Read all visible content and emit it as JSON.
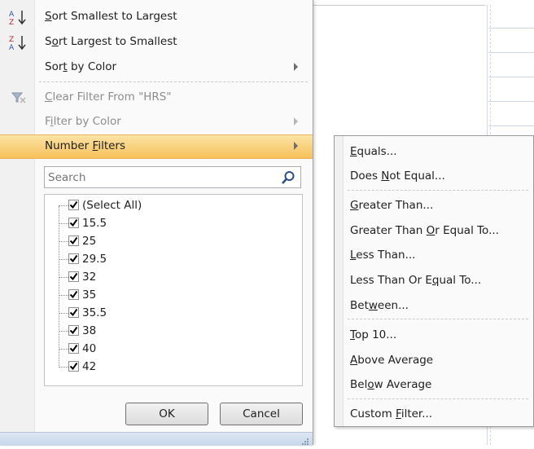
{
  "sort_menu": {
    "sort_asc": {
      "pre": "",
      "u": "S",
      "post": "ort Smallest to Largest",
      "icon": "sort-ascending-icon",
      "glyph_top": "A",
      "glyph_bottom": "Z"
    },
    "sort_desc": {
      "pre": "S",
      "u": "o",
      "post": "rt Largest to Smallest",
      "icon": "sort-descending-icon",
      "glyph_top": "Z",
      "glyph_bottom": "A"
    },
    "sort_by_color": {
      "pre": "Sor",
      "u": "t",
      "post": " by Color"
    }
  },
  "filter_menu": {
    "clear_filter": {
      "pre": "",
      "u": "C",
      "post": "lear Filter From \"HRS\"",
      "icon": "clear-filter-icon"
    },
    "filter_by_color": {
      "pre": "F",
      "u": "i",
      "post": "lter by Color"
    },
    "number_filters": {
      "pre": "Number ",
      "u": "F",
      "post": "ilters"
    }
  },
  "search": {
    "placeholder": "Search",
    "icon": "search-icon"
  },
  "values": {
    "select_all": "(Select All)",
    "items": [
      "15.5",
      "25",
      "29.5",
      "32",
      "35",
      "35.5",
      "38",
      "40",
      "42"
    ]
  },
  "buttons": {
    "ok": "OK",
    "cancel": "Cancel"
  },
  "submenu": {
    "equals": {
      "pre": "",
      "u": "E",
      "post": "quals..."
    },
    "does_not_equal": {
      "pre": "Does ",
      "u": "N",
      "post": "ot Equal..."
    },
    "greater_than": {
      "pre": "",
      "u": "G",
      "post": "reater Than..."
    },
    "greater_equal": {
      "pre": "Greater Than ",
      "u": "O",
      "post": "r Equal To..."
    },
    "less_than": {
      "pre": "",
      "u": "L",
      "post": "ess Than..."
    },
    "less_equal": {
      "pre": "Less Than Or E",
      "u": "q",
      "post": "ual To..."
    },
    "between": {
      "pre": "Bet",
      "u": "w",
      "post": "een..."
    },
    "top10": {
      "pre": "",
      "u": "T",
      "post": "op 10..."
    },
    "above_average": {
      "pre": "",
      "u": "A",
      "post": "bove Average"
    },
    "below_average": {
      "pre": "Bel",
      "u": "o",
      "post": "w Average"
    },
    "custom_filter": {
      "pre": "Custom ",
      "u": "F",
      "post": "ilter..."
    }
  },
  "colors": {
    "highlight": "#f7c159",
    "gutter": "#f1f1f1"
  }
}
